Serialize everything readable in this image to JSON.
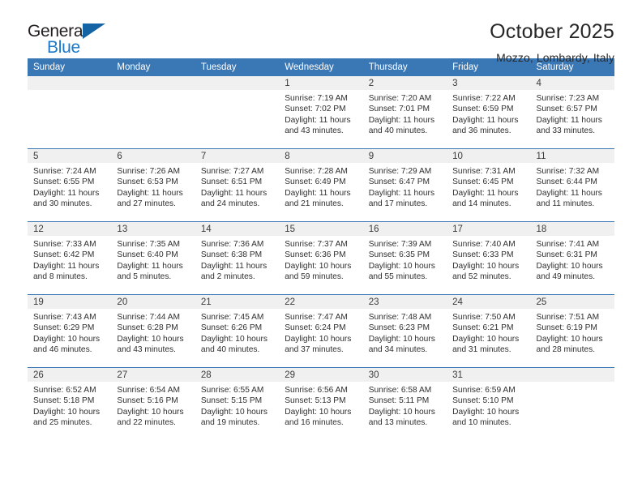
{
  "logo": {
    "text_top": "General",
    "text_bottom": "Blue",
    "triangle_color": "#1464a5",
    "blue_color": "#1b79c8"
  },
  "header": {
    "title": "October 2025",
    "subtitle": "Mozzo, Lombardy, Italy"
  },
  "theme": {
    "header_blue": "#3a77b5",
    "daynum_band": "#f0f0f0",
    "text": "#2f2f2f"
  },
  "weekday_headers": [
    "Sunday",
    "Monday",
    "Tuesday",
    "Wednesday",
    "Thursday",
    "Friday",
    "Saturday"
  ],
  "weeks": [
    [
      {
        "day": "",
        "sunrise": "",
        "sunset": "",
        "daylight_line1": "",
        "daylight_line2": ""
      },
      {
        "day": "",
        "sunrise": "",
        "sunset": "",
        "daylight_line1": "",
        "daylight_line2": ""
      },
      {
        "day": "",
        "sunrise": "",
        "sunset": "",
        "daylight_line1": "",
        "daylight_line2": ""
      },
      {
        "day": "1",
        "sunrise": "Sunrise: 7:19 AM",
        "sunset": "Sunset: 7:02 PM",
        "daylight_line1": "Daylight: 11 hours",
        "daylight_line2": "and 43 minutes."
      },
      {
        "day": "2",
        "sunrise": "Sunrise: 7:20 AM",
        "sunset": "Sunset: 7:01 PM",
        "daylight_line1": "Daylight: 11 hours",
        "daylight_line2": "and 40 minutes."
      },
      {
        "day": "3",
        "sunrise": "Sunrise: 7:22 AM",
        "sunset": "Sunset: 6:59 PM",
        "daylight_line1": "Daylight: 11 hours",
        "daylight_line2": "and 36 minutes."
      },
      {
        "day": "4",
        "sunrise": "Sunrise: 7:23 AM",
        "sunset": "Sunset: 6:57 PM",
        "daylight_line1": "Daylight: 11 hours",
        "daylight_line2": "and 33 minutes."
      }
    ],
    [
      {
        "day": "5",
        "sunrise": "Sunrise: 7:24 AM",
        "sunset": "Sunset: 6:55 PM",
        "daylight_line1": "Daylight: 11 hours",
        "daylight_line2": "and 30 minutes."
      },
      {
        "day": "6",
        "sunrise": "Sunrise: 7:26 AM",
        "sunset": "Sunset: 6:53 PM",
        "daylight_line1": "Daylight: 11 hours",
        "daylight_line2": "and 27 minutes."
      },
      {
        "day": "7",
        "sunrise": "Sunrise: 7:27 AM",
        "sunset": "Sunset: 6:51 PM",
        "daylight_line1": "Daylight: 11 hours",
        "daylight_line2": "and 24 minutes."
      },
      {
        "day": "8",
        "sunrise": "Sunrise: 7:28 AM",
        "sunset": "Sunset: 6:49 PM",
        "daylight_line1": "Daylight: 11 hours",
        "daylight_line2": "and 21 minutes."
      },
      {
        "day": "9",
        "sunrise": "Sunrise: 7:29 AM",
        "sunset": "Sunset: 6:47 PM",
        "daylight_line1": "Daylight: 11 hours",
        "daylight_line2": "and 17 minutes."
      },
      {
        "day": "10",
        "sunrise": "Sunrise: 7:31 AM",
        "sunset": "Sunset: 6:45 PM",
        "daylight_line1": "Daylight: 11 hours",
        "daylight_line2": "and 14 minutes."
      },
      {
        "day": "11",
        "sunrise": "Sunrise: 7:32 AM",
        "sunset": "Sunset: 6:44 PM",
        "daylight_line1": "Daylight: 11 hours",
        "daylight_line2": "and 11 minutes."
      }
    ],
    [
      {
        "day": "12",
        "sunrise": "Sunrise: 7:33 AM",
        "sunset": "Sunset: 6:42 PM",
        "daylight_line1": "Daylight: 11 hours",
        "daylight_line2": "and 8 minutes."
      },
      {
        "day": "13",
        "sunrise": "Sunrise: 7:35 AM",
        "sunset": "Sunset: 6:40 PM",
        "daylight_line1": "Daylight: 11 hours",
        "daylight_line2": "and 5 minutes."
      },
      {
        "day": "14",
        "sunrise": "Sunrise: 7:36 AM",
        "sunset": "Sunset: 6:38 PM",
        "daylight_line1": "Daylight: 11 hours",
        "daylight_line2": "and 2 minutes."
      },
      {
        "day": "15",
        "sunrise": "Sunrise: 7:37 AM",
        "sunset": "Sunset: 6:36 PM",
        "daylight_line1": "Daylight: 10 hours",
        "daylight_line2": "and 59 minutes."
      },
      {
        "day": "16",
        "sunrise": "Sunrise: 7:39 AM",
        "sunset": "Sunset: 6:35 PM",
        "daylight_line1": "Daylight: 10 hours",
        "daylight_line2": "and 55 minutes."
      },
      {
        "day": "17",
        "sunrise": "Sunrise: 7:40 AM",
        "sunset": "Sunset: 6:33 PM",
        "daylight_line1": "Daylight: 10 hours",
        "daylight_line2": "and 52 minutes."
      },
      {
        "day": "18",
        "sunrise": "Sunrise: 7:41 AM",
        "sunset": "Sunset: 6:31 PM",
        "daylight_line1": "Daylight: 10 hours",
        "daylight_line2": "and 49 minutes."
      }
    ],
    [
      {
        "day": "19",
        "sunrise": "Sunrise: 7:43 AM",
        "sunset": "Sunset: 6:29 PM",
        "daylight_line1": "Daylight: 10 hours",
        "daylight_line2": "and 46 minutes."
      },
      {
        "day": "20",
        "sunrise": "Sunrise: 7:44 AM",
        "sunset": "Sunset: 6:28 PM",
        "daylight_line1": "Daylight: 10 hours",
        "daylight_line2": "and 43 minutes."
      },
      {
        "day": "21",
        "sunrise": "Sunrise: 7:45 AM",
        "sunset": "Sunset: 6:26 PM",
        "daylight_line1": "Daylight: 10 hours",
        "daylight_line2": "and 40 minutes."
      },
      {
        "day": "22",
        "sunrise": "Sunrise: 7:47 AM",
        "sunset": "Sunset: 6:24 PM",
        "daylight_line1": "Daylight: 10 hours",
        "daylight_line2": "and 37 minutes."
      },
      {
        "day": "23",
        "sunrise": "Sunrise: 7:48 AM",
        "sunset": "Sunset: 6:23 PM",
        "daylight_line1": "Daylight: 10 hours",
        "daylight_line2": "and 34 minutes."
      },
      {
        "day": "24",
        "sunrise": "Sunrise: 7:50 AM",
        "sunset": "Sunset: 6:21 PM",
        "daylight_line1": "Daylight: 10 hours",
        "daylight_line2": "and 31 minutes."
      },
      {
        "day": "25",
        "sunrise": "Sunrise: 7:51 AM",
        "sunset": "Sunset: 6:19 PM",
        "daylight_line1": "Daylight: 10 hours",
        "daylight_line2": "and 28 minutes."
      }
    ],
    [
      {
        "day": "26",
        "sunrise": "Sunrise: 6:52 AM",
        "sunset": "Sunset: 5:18 PM",
        "daylight_line1": "Daylight: 10 hours",
        "daylight_line2": "and 25 minutes."
      },
      {
        "day": "27",
        "sunrise": "Sunrise: 6:54 AM",
        "sunset": "Sunset: 5:16 PM",
        "daylight_line1": "Daylight: 10 hours",
        "daylight_line2": "and 22 minutes."
      },
      {
        "day": "28",
        "sunrise": "Sunrise: 6:55 AM",
        "sunset": "Sunset: 5:15 PM",
        "daylight_line1": "Daylight: 10 hours",
        "daylight_line2": "and 19 minutes."
      },
      {
        "day": "29",
        "sunrise": "Sunrise: 6:56 AM",
        "sunset": "Sunset: 5:13 PM",
        "daylight_line1": "Daylight: 10 hours",
        "daylight_line2": "and 16 minutes."
      },
      {
        "day": "30",
        "sunrise": "Sunrise: 6:58 AM",
        "sunset": "Sunset: 5:11 PM",
        "daylight_line1": "Daylight: 10 hours",
        "daylight_line2": "and 13 minutes."
      },
      {
        "day": "31",
        "sunrise": "Sunrise: 6:59 AM",
        "sunset": "Sunset: 5:10 PM",
        "daylight_line1": "Daylight: 10 hours",
        "daylight_line2": "and 10 minutes."
      },
      {
        "day": "",
        "sunrise": "",
        "sunset": "",
        "daylight_line1": "",
        "daylight_line2": ""
      }
    ]
  ]
}
